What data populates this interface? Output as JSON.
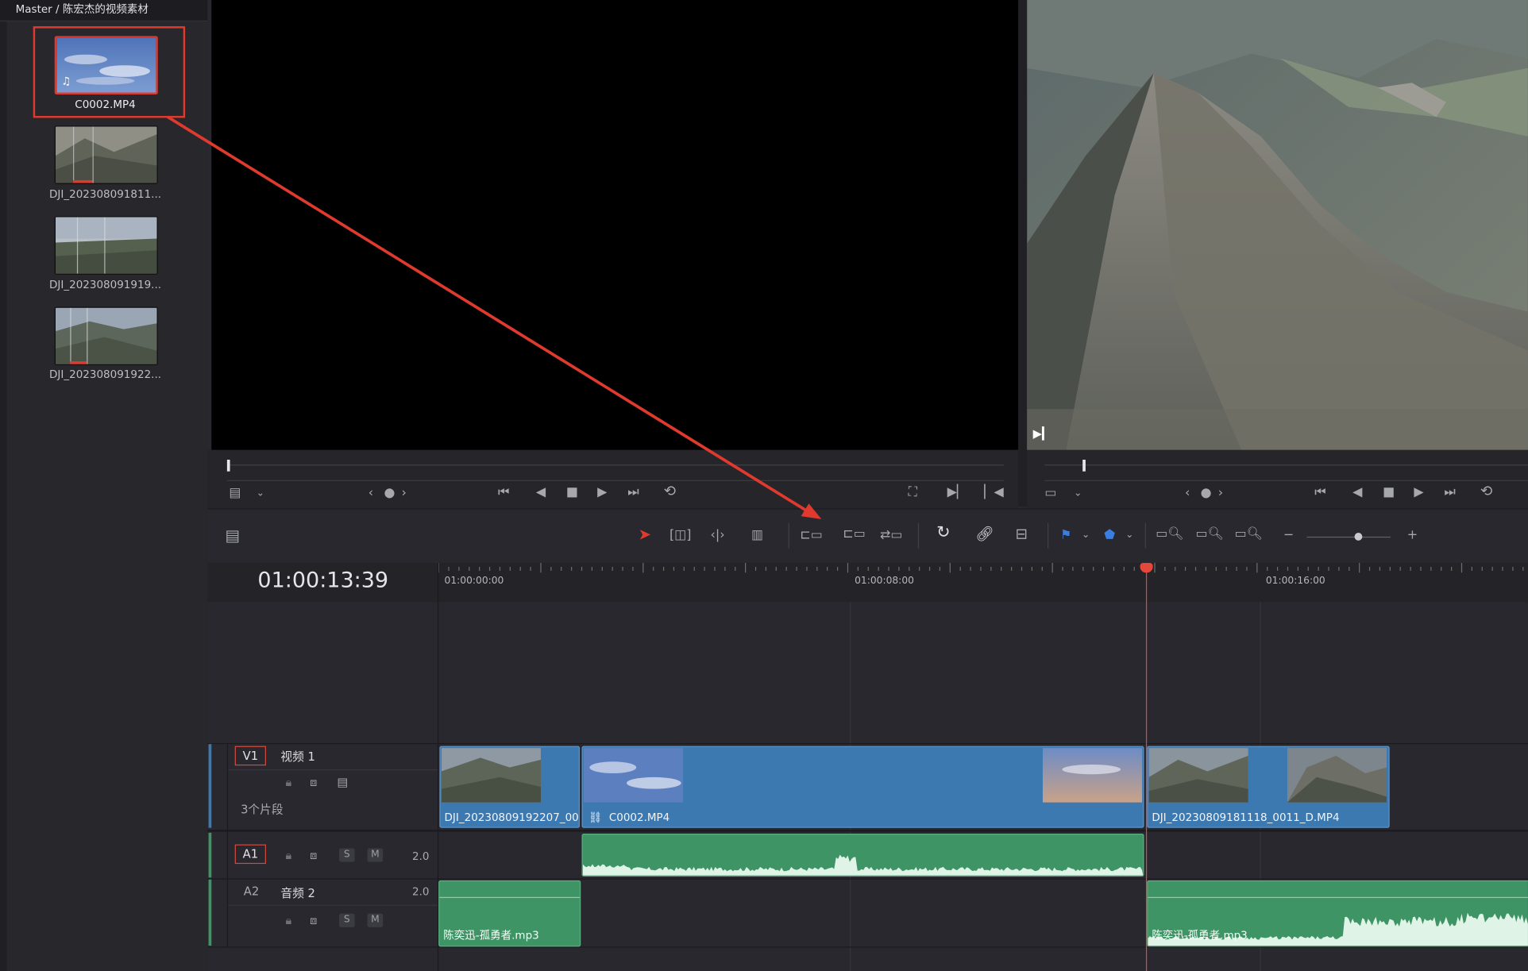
{
  "media_pool": {
    "breadcrumb": "Master / 陈宏杰的视频素材",
    "clips": [
      {
        "name": "C0002.MP4"
      },
      {
        "name": "DJI_202308091811..."
      },
      {
        "name": "DJI_202308091919..."
      },
      {
        "name": "DJI_202308091922..."
      }
    ]
  },
  "timeline": {
    "timecode": "01:00:13:39",
    "ruler_labels": [
      "01:00:00:00",
      "01:00:08:00",
      "01:00:16:00"
    ],
    "tracks": {
      "v1": {
        "badge": "V1",
        "name": "视频 1",
        "clip_count": "3个片段"
      },
      "a1": {
        "badge": "A1",
        "channels": "2.0"
      },
      "a2": {
        "badge": "A2",
        "name": "音频 2",
        "channels": "2.0"
      }
    },
    "video_clips": [
      {
        "name": "DJI_20230809192207_00..."
      },
      {
        "name": "C0002.MP4"
      },
      {
        "name": "DJI_20230809181118_0011_D.MP4"
      }
    ],
    "audio_clips": [
      {
        "name": "陈奕迅-孤勇者.mp3"
      },
      {
        "name": "陈奕迅-孤勇者.mp3"
      }
    ],
    "solo_label": "S",
    "mute_label": "M"
  },
  "colors": {
    "accent_red": "#e03a2f",
    "video_clip": "#3d79b1",
    "audio_clip": "#3f9466",
    "playhead": "#e5473b"
  }
}
